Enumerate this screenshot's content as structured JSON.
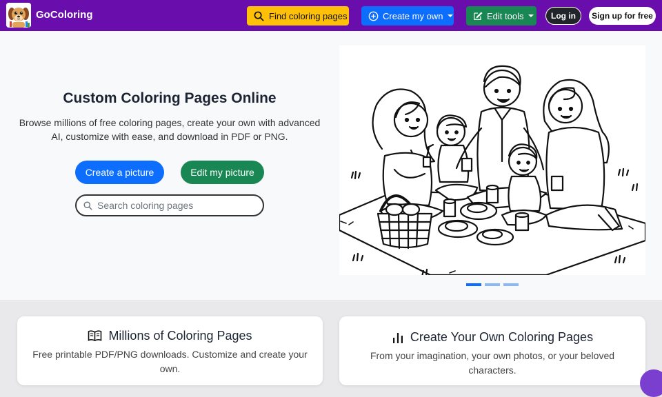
{
  "nav": {
    "brand": "GoColoring",
    "find_label": "Find coloring pages",
    "create_label": "Create my own",
    "edit_label": "Edit tools",
    "login_label": "Log in",
    "signup_label": "Sign up for free"
  },
  "hero": {
    "title": "Custom Coloring Pages Online",
    "subtitle": "Browse millions of free coloring pages, create your own with advanced AI, customize with ease, and download in PDF or PNG.",
    "create_button": "Create a picture",
    "edit_button": "Edit my picture",
    "search_placeholder": "Search coloring pages",
    "carousel": {
      "slides": 3,
      "active": 1
    }
  },
  "cards": [
    {
      "icon": "book-icon",
      "title": "Millions of Coloring Pages",
      "desc": "Free printable PDF/PNG downloads. Customize and create your own."
    },
    {
      "icon": "bar-chart-icon",
      "title": "Create Your Own Coloring Pages",
      "desc": "From your imagination, your own photos, or your beloved characters."
    }
  ],
  "colors": {
    "nav_bg": "#6a0dad",
    "find": "#ffc107",
    "primary": "#0d6efd",
    "success": "#198754",
    "dark": "#212529"
  }
}
